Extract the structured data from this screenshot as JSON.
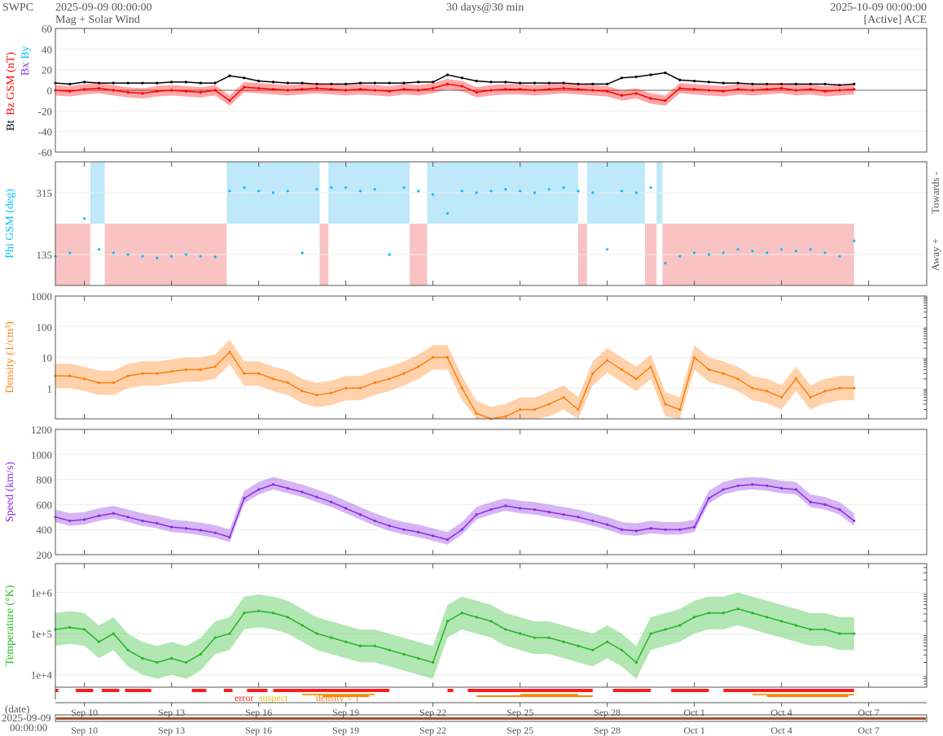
{
  "header": {
    "org": "SWPC",
    "start": "2025-09-09 00:00:00",
    "product": "Mag + Solar Wind",
    "span": "30 days@30 min",
    "end": "2025-10-09 00:00:00",
    "source": "[Active] ACE"
  },
  "colors": {
    "bt": "#000000",
    "bz": "#ff0000",
    "bx": "#8a2be2",
    "by": "#00bfff",
    "density": "#ff7f0e",
    "speed": "#8a2be2",
    "temp": "#22b822",
    "towards": "#bfe8fb",
    "away": "#f9c3c3",
    "axis": "#555555"
  },
  "chart_data": [
    {
      "type": "line",
      "id": "mag",
      "ylabel_parts": [
        "Bt",
        "Bz GSM (nT)",
        "Bx",
        "By"
      ],
      "ylim": [
        -60,
        60
      ],
      "scale": "linear",
      "ticks": [
        60,
        40,
        20,
        0,
        -20,
        -40,
        -60
      ],
      "tick_labels": [
        "60",
        "40",
        "20",
        "0",
        "-20",
        "-40",
        "-60"
      ],
      "x_days_step": 0.5,
      "series": [
        {
          "name": "Bt",
          "values": [
            7,
            6,
            8,
            7,
            7,
            7,
            7,
            7,
            8,
            8,
            7,
            7,
            14,
            12,
            9,
            8,
            7,
            7,
            6,
            6,
            6,
            7,
            7,
            7,
            7,
            8,
            8,
            15,
            12,
            9,
            8,
            8,
            7,
            7,
            7,
            7,
            6,
            6,
            6,
            12,
            13,
            15,
            17,
            10,
            9,
            8,
            7,
            7,
            6,
            6,
            6,
            6,
            6,
            6,
            5,
            6
          ]
        },
        {
          "name": "Bz",
          "values": [
            0,
            -1,
            1,
            2,
            0,
            -2,
            -3,
            -1,
            0,
            -1,
            -2,
            0,
            -10,
            3,
            2,
            1,
            0,
            1,
            2,
            1,
            0,
            1,
            0,
            -1,
            1,
            0,
            2,
            6,
            4,
            -2,
            0,
            1,
            1,
            0,
            1,
            2,
            1,
            0,
            -1,
            -5,
            -3,
            -8,
            -10,
            2,
            1,
            0,
            -1,
            1,
            0,
            1,
            2,
            0,
            1,
            -1,
            0,
            1
          ]
        }
      ]
    },
    {
      "type": "scatter",
      "id": "phi",
      "ylabel": "Phi GSM (deg)",
      "right_labels": [
        "Towards -",
        "Away +"
      ],
      "ylim": [
        45,
        405
      ],
      "scale": "linear",
      "ticks": [
        315,
        135
      ],
      "tick_labels": [
        "315",
        "135"
      ],
      "x_days_step": 0.5,
      "series": [
        {
          "name": "Phi",
          "values": [
            130,
            140,
            240,
            150,
            140,
            135,
            130,
            125,
            130,
            135,
            130,
            128,
            320,
            330,
            320,
            315,
            320,
            140,
            325,
            330,
            330,
            320,
            325,
            135,
            330,
            320,
            310,
            255,
            320,
            315,
            320,
            325,
            320,
            315,
            325,
            330,
            320,
            315,
            150,
            320,
            315,
            330,
            110,
            130,
            140,
            135,
            140,
            150,
            145,
            140,
            150,
            145,
            150,
            140,
            130,
            175
          ]
        }
      ],
      "sectors": [
        {
          "start": 0,
          "end": 1.2,
          "sector": "away"
        },
        {
          "start": 1.2,
          "end": 1.7,
          "sector": "towards"
        },
        {
          "start": 1.7,
          "end": 5.9,
          "sector": "away"
        },
        {
          "start": 5.9,
          "end": 9.1,
          "sector": "towards"
        },
        {
          "start": 9.1,
          "end": 9.4,
          "sector": "away"
        },
        {
          "start": 9.4,
          "end": 12.2,
          "sector": "towards"
        },
        {
          "start": 12.2,
          "end": 12.8,
          "sector": "away"
        },
        {
          "start": 12.8,
          "end": 18.0,
          "sector": "towards"
        },
        {
          "start": 18.0,
          "end": 18.3,
          "sector": "away"
        },
        {
          "start": 18.3,
          "end": 20.3,
          "sector": "towards"
        },
        {
          "start": 20.3,
          "end": 20.7,
          "sector": "away"
        },
        {
          "start": 20.7,
          "end": 20.9,
          "sector": "towards"
        },
        {
          "start": 20.9,
          "end": 27.5,
          "sector": "away"
        }
      ]
    },
    {
      "type": "line",
      "id": "density",
      "ylabel": "Density (1/cm³)",
      "ylim": [
        0.1,
        1000
      ],
      "scale": "log",
      "ticks": [
        1000,
        100,
        10,
        1
      ],
      "tick_labels": [
        "1000",
        "100",
        "10",
        "1"
      ],
      "x_days_step": 0.5,
      "series": [
        {
          "name": "Density",
          "values": [
            2.5,
            2.5,
            2,
            1.5,
            1.5,
            2.5,
            3,
            3,
            3.5,
            4,
            4,
            5,
            15,
            3,
            3,
            2,
            1.5,
            0.8,
            0.6,
            0.7,
            1,
            1,
            1.5,
            2,
            3,
            5,
            10,
            10,
            1,
            0.15,
            0.1,
            0.12,
            0.2,
            0.2,
            0.3,
            0.5,
            0.2,
            3,
            8,
            4,
            2,
            5,
            0.3,
            0.2,
            10,
            4,
            3,
            2,
            1,
            0.8,
            0.5,
            2,
            0.5,
            0.8,
            1,
            1
          ]
        }
      ]
    },
    {
      "type": "line",
      "id": "speed",
      "ylabel": "Speed (km/s)",
      "ylim": [
        200,
        1200
      ],
      "scale": "linear",
      "ticks": [
        1200,
        1000,
        800,
        600,
        400,
        200
      ],
      "tick_labels": [
        "1200",
        "1000",
        "800",
        "600",
        "400",
        "200"
      ],
      "x_days_step": 0.5,
      "series": [
        {
          "name": "Speed",
          "values": [
            500,
            470,
            480,
            510,
            530,
            500,
            470,
            450,
            420,
            410,
            395,
            375,
            340,
            650,
            720,
            760,
            730,
            700,
            660,
            620,
            570,
            520,
            470,
            430,
            400,
            380,
            350,
            320,
            400,
            520,
            560,
            590,
            570,
            560,
            540,
            520,
            500,
            470,
            440,
            400,
            390,
            410,
            400,
            400,
            420,
            650,
            720,
            750,
            760,
            750,
            730,
            720,
            620,
            600,
            560,
            470
          ]
        }
      ]
    },
    {
      "type": "line",
      "id": "temperature",
      "ylabel": "Temperature (°K)",
      "ylim": [
        5000,
        5000000
      ],
      "scale": "log",
      "ticks": [
        1000000,
        100000,
        10000
      ],
      "tick_labels": [
        "1e+6",
        "1e+5",
        "1e+4"
      ],
      "x_days_step": 0.5,
      "series": [
        {
          "name": "Temperature_log10",
          "values": [
            5.1,
            5.15,
            5.1,
            4.8,
            5.0,
            4.6,
            4.4,
            4.3,
            4.4,
            4.3,
            4.5,
            4.9,
            5.0,
            5.5,
            5.55,
            5.5,
            5.4,
            5.2,
            5.0,
            4.9,
            4.8,
            4.7,
            4.7,
            4.6,
            4.5,
            4.4,
            4.3,
            5.3,
            5.5,
            5.4,
            5.3,
            5.1,
            5.0,
            4.9,
            4.9,
            4.8,
            4.7,
            4.6,
            4.8,
            4.6,
            4.3,
            5.0,
            5.1,
            5.2,
            5.4,
            5.5,
            5.5,
            5.6,
            5.5,
            5.4,
            5.3,
            5.2,
            5.1,
            5.1,
            5.0,
            5.0
          ]
        }
      ]
    }
  ],
  "flags": {
    "legend": [
      "error",
      "suspect",
      "density < 1"
    ],
    "error": [
      [
        0,
        0.1
      ],
      [
        0.7,
        1.3
      ],
      [
        1.6,
        2.2
      ],
      [
        2.4,
        3.3
      ],
      [
        4.7,
        5.2
      ],
      [
        5.8,
        6.1
      ],
      [
        6.6,
        7.3
      ],
      [
        7.5,
        11.5
      ],
      [
        13.5,
        13.7
      ],
      [
        14.2,
        18.5
      ],
      [
        19.2,
        20.5
      ],
      [
        21.2,
        22.5
      ],
      [
        23,
        27.5
      ]
    ],
    "suspect": [
      [
        8.5,
        11
      ],
      [
        16,
        18
      ],
      [
        24,
        27.5
      ]
    ],
    "density_lt_1": [
      [
        9.2,
        10.8
      ],
      [
        14.5,
        18.5
      ],
      [
        24.5,
        27.3
      ]
    ]
  },
  "xaxis": {
    "date_label": "(date)",
    "date_value": "2025-09-09",
    "time_value": "00:00:00",
    "ticks": [
      {
        "day": 1,
        "label": "Sep 10"
      },
      {
        "day": 4,
        "label": "Sep 13"
      },
      {
        "day": 7,
        "label": "Sep 16"
      },
      {
        "day": 10,
        "label": "Sep 19"
      },
      {
        "day": 13,
        "label": "Sep 22"
      },
      {
        "day": 16,
        "label": "Sep 25"
      },
      {
        "day": 19,
        "label": "Sep 28"
      },
      {
        "day": 22,
        "label": "Oct 1"
      },
      {
        "day": 25,
        "label": "Oct 4"
      },
      {
        "day": 28,
        "label": "Oct 7"
      }
    ],
    "total_days": 30
  }
}
